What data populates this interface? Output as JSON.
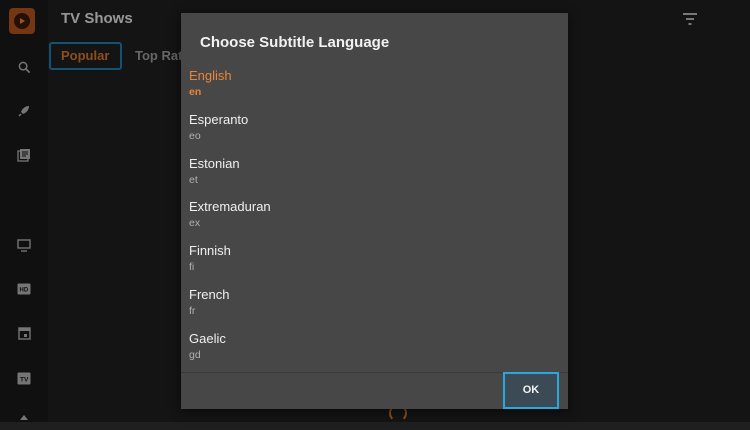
{
  "header": {
    "title": "TV Shows"
  },
  "tabs": [
    {
      "label": "Popular",
      "active": true
    },
    {
      "label": "Top Rat"
    }
  ],
  "sidebar": {
    "icons": [
      "app-logo",
      "search-icon",
      "rocket-icon",
      "library-icon",
      "tv-icon",
      "hd-icon",
      "calendar-icon",
      "tv-badge-icon",
      "upload-icon"
    ]
  },
  "dialog": {
    "title": "Choose Subtitle Language",
    "languages": [
      {
        "name": "English",
        "code": "en",
        "selected": true
      },
      {
        "name": "Esperanto",
        "code": "eo"
      },
      {
        "name": "Estonian",
        "code": "et"
      },
      {
        "name": "Extremaduran",
        "code": "ex"
      },
      {
        "name": "Finnish",
        "code": "fi"
      },
      {
        "name": "French",
        "code": "fr"
      },
      {
        "name": "Gaelic",
        "code": "gd"
      }
    ],
    "ok_label": "OK"
  },
  "colors": {
    "accent": "#e8853a",
    "focus": "#29a8e0",
    "dialog_bg": "#474747"
  }
}
